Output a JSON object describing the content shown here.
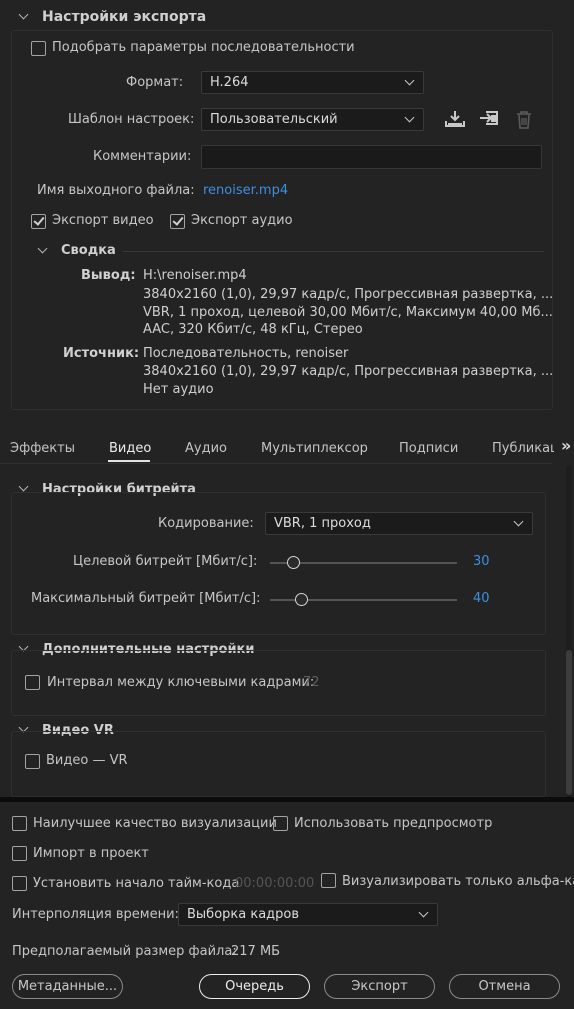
{
  "export_settings": {
    "title": "Настройки экспорта",
    "match_sequence_label": "Подобрать параметры последовательности",
    "match_sequence_checked": false,
    "format_label": "Формат:",
    "format_value": "H.264",
    "preset_label": "Шаблон настроек:",
    "preset_value": "Пользовательский",
    "comments_label": "Комментарии:",
    "comments_value": "",
    "output_name_label": "Имя выходного файла:",
    "output_name_value": "renoiser.mp4",
    "export_video_label": "Экспорт видео",
    "export_video_checked": true,
    "export_audio_label": "Экспорт аудио",
    "export_audio_checked": true,
    "icons": [
      "save-preset-icon",
      "import-preset-icon",
      "trash-icon"
    ]
  },
  "summary": {
    "title": "Сводка",
    "output_label": "Вывод:",
    "output_lines": [
      "H:\\renoiser.mp4",
      "3840x2160 (1,0), 29,97 кадр/с, Прогрессивная развертка, ...",
      "VBR, 1 проход, целевой 30,00 Мбит/с, Максимум 40,00 Мб...",
      "AAC, 320 Кбит/с, 48 кГц, Стерео"
    ],
    "source_label": "Источник:",
    "source_lines": [
      "Последовательность, renoiser",
      "3840x2160 (1,0), 29,97 кадр/с, Прогрессивная развертка, ...",
      "Нет аудио"
    ]
  },
  "tabs": {
    "items": [
      "Эффекты",
      "Видео",
      "Аудио",
      "Мультиплексор",
      "Подписи",
      "Публикац"
    ],
    "active": "Видео",
    "more_label": "»"
  },
  "bitrate": {
    "title": "Настройки битрейта",
    "encoding_label": "Кодирование:",
    "encoding_value": "VBR, 1 проход",
    "target_label": "Целевой битрейт [Мбит/с]:",
    "target_value": "30",
    "max_label": "Максимальный битрейт [Мбит/с]:",
    "max_value": "40"
  },
  "advanced": {
    "title": "Дополнительные настройки",
    "keyframe_label": "Интервал между ключевыми кадрами:",
    "keyframe_value": "72",
    "keyframe_checked": false
  },
  "vr": {
    "title": "Видео VR",
    "vr_label": "Видео — VR",
    "vr_checked": false
  },
  "bottom": {
    "best_quality_label": "Наилучшее качество визуализации",
    "use_preview_label": "Использовать предпросмотр",
    "import_label": "Импорт в проект",
    "timecode_label": "Установить начало тайм-кода",
    "timecode_value": "00:00:00:00",
    "alpha_label": "Визуализировать только альфа-канал",
    "interp_label": "Интерполяция времени:",
    "interp_value": "Выборка кадров",
    "filesize_label": "Предполагаемый размер файла:",
    "filesize_value": "217 МБ"
  },
  "buttons": {
    "metadata": "Метаданные...",
    "queue": "Очередь",
    "export": "Экспорт",
    "cancel": "Отмена"
  },
  "colors": {
    "accent_blue": "#3d8fe0",
    "background": "#232323"
  }
}
